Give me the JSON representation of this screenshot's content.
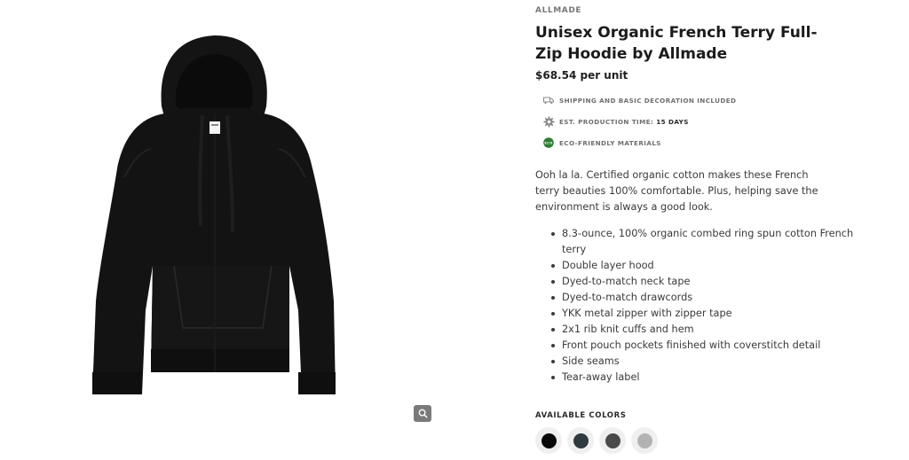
{
  "product": {
    "brand": "ALLMADE",
    "title": "Unisex Organic French Terry Full-Zip Hoodie by Allmade",
    "price": "$68.54 per unit"
  },
  "features": [
    {
      "icon": "truck-icon",
      "label": "SHIPPING AND BASIC DECORATION INCLUDED",
      "value": ""
    },
    {
      "icon": "gear-icon",
      "label": "EST. PRODUCTION TIME:",
      "value": "15 DAYS"
    },
    {
      "icon": "eco-badge-icon",
      "label": "ECO-FRIENDLY MATERIALS",
      "value": "",
      "badge_text": "ECO"
    }
  ],
  "description": "Ooh la la. Certified organic cotton makes these French terry beauties 100% comfortable. Plus, helping save the environment is always a good look.",
  "bullets": [
    "8.3-ounce, 100% organic combed ring spun cotton French terry",
    "Double layer hood",
    "Dyed-to-match neck tape",
    "Dyed-to-match drawcords",
    "YKK metal zipper with zipper tape",
    "2x1 rib knit cuffs and hem",
    "Front pouch pockets finished with coverstitch detail",
    "Side seams",
    "Tear-away label"
  ],
  "colors": {
    "heading": "AVAILABLE COLORS",
    "swatches": [
      "#0a0a0a",
      "#2f3a40",
      "#4a4a4a",
      "#b3b3b3"
    ]
  },
  "image": {
    "icon": "zoom-icon",
    "garment_color": "#111111",
    "background": "#ffffff"
  },
  "theme": {
    "eco_green": "#2e7d32",
    "zoom_button": "#7a7a7a"
  }
}
